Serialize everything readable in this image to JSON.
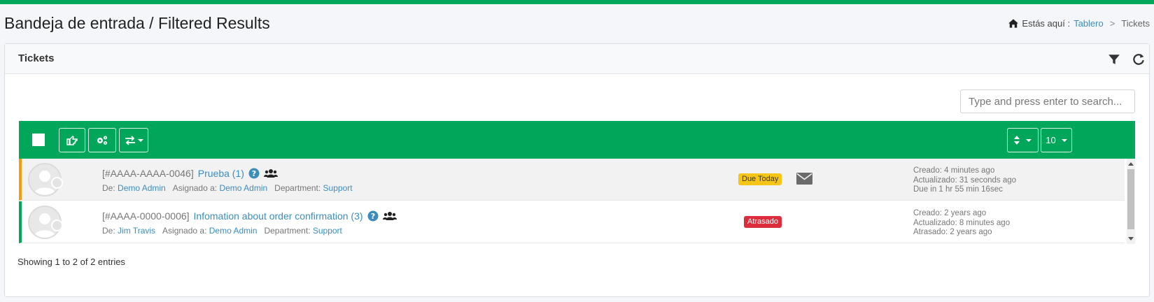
{
  "header": {
    "title": "Bandeja de entrada / Filtered Results",
    "breadcrumb": {
      "prefix": "Estás aquí :",
      "link": "Tablero",
      "separator": ">",
      "current": "Tickets"
    }
  },
  "box": {
    "title": "Tickets",
    "tools": [
      "filter-icon",
      "refresh-icon"
    ]
  },
  "search": {
    "placeholder": "Type and press enter to search...",
    "value": ""
  },
  "toolbar": {
    "page_size": "10",
    "buttons": [
      "assign-hand-icon",
      "settings-cogs-icon",
      "transfer-arrows-icon",
      "sort-icon"
    ]
  },
  "tickets": [
    {
      "id": "[#AAAA-AAAA-0046]",
      "subject": "Prueba (1)",
      "from_label": "De:",
      "from": "Demo Admin",
      "assigned_label": "Asignado a:",
      "assigned": "Demo Admin",
      "dept_label": "Department:",
      "dept": "Support",
      "badge": "Due Today",
      "badge_color": "#f5c518",
      "stripe_color": "#f39c12",
      "created": "Creado: 4 minutes ago",
      "updated": "Actualizado: 31 seconds ago",
      "due": "Due in 1 hr 55 min 16sec"
    },
    {
      "id": "[#AAAA-0000-0006]",
      "subject": "Infomation about order confirmation (3)",
      "from_label": "De:",
      "from": "Jim Travis",
      "assigned_label": "Asignado a:",
      "assigned": "Demo Admin",
      "dept_label": "Department:",
      "dept": "Support",
      "badge": "Atrasado",
      "badge_color": "#dd2c3c",
      "stripe_color": "#00a65a",
      "created": "Creado: 2 years ago",
      "updated": "Actualizado: 8 minutes ago",
      "due": "Atrasado: 2 years ago"
    }
  ],
  "footer": {
    "info": "Showing 1 to 2 of 2 entries"
  },
  "colors": {
    "brand_green": "#00a65a",
    "link_blue": "#3c8dbc"
  }
}
